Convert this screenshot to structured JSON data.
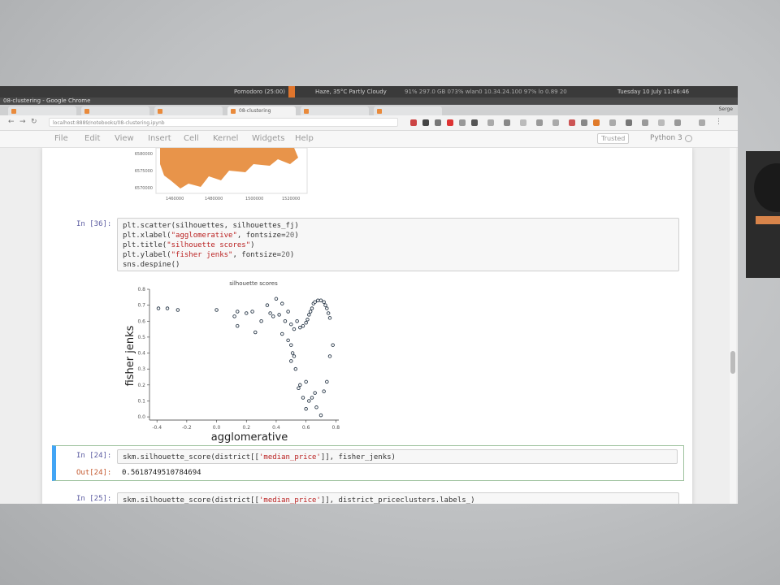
{
  "system_bar": {
    "left_text": "Pomodoro (25:00)",
    "weather": "Haze, 35°C Partly Cloudy",
    "stats": "91% 297.0 GB 073% wlan0 10.34.24.100 97% lo 0.89 20",
    "datetime": "Tuesday 10 July 11:46:46"
  },
  "window": {
    "title": "08-clustering - Google Chrome",
    "tabs": [
      {
        "label": "",
        "active": false
      },
      {
        "label": "",
        "active": false
      },
      {
        "label": "08-clustering",
        "active": true
      },
      {
        "label": "",
        "active": false
      },
      {
        "label": "",
        "active": false
      }
    ],
    "user": "Serge"
  },
  "address": {
    "url": "localhost:8889/notebooks/08-clustering.ipynb"
  },
  "menubar": {
    "items": [
      "File",
      "Edit",
      "View",
      "Insert",
      "Cell",
      "Kernel",
      "Widgets",
      "Help"
    ],
    "trusted": "Trusted",
    "kernel": "Python 3"
  },
  "map_plot": {
    "y_ticks": [
      "6580000",
      "6575000",
      "6570000"
    ],
    "x_ticks": [
      "1460000",
      "1480000",
      "1500000",
      "1520000"
    ],
    "fill_color": "#e8944a"
  },
  "cell36": {
    "prompt": "In [36]:",
    "lines": [
      [
        "plt.scatter(silhouettes, silhouettes_fj)"
      ],
      [
        "plt.xlabel(",
        "\"agglomerative\"",
        ", fontsize=",
        "20",
        ")"
      ],
      [
        "plt.title(",
        "\"silhouette scores\"",
        ")"
      ],
      [
        "plt.ylabel(",
        "\"fisher jenks\"",
        ", fontsize=",
        "20",
        ")"
      ],
      [
        "sns.despine()"
      ]
    ]
  },
  "chart_data": {
    "type": "scatter",
    "title": "silhouette scores",
    "xlabel": "agglomerative",
    "ylabel": "fisher jenks",
    "xlim": [
      -0.45,
      0.82
    ],
    "ylim": [
      -0.02,
      0.8
    ],
    "x_ticks": [
      "-0.4",
      "-0.2",
      "0.0",
      "0.2",
      "0.4",
      "0.6",
      "0.8"
    ],
    "y_ticks": [
      "0.0",
      "0.1",
      "0.2",
      "0.3",
      "0.4",
      "0.5",
      "0.6",
      "0.7",
      "0.8"
    ],
    "points": [
      [
        -0.39,
        0.68
      ],
      [
        -0.33,
        0.68
      ],
      [
        -0.26,
        0.67
      ],
      [
        0.0,
        0.67
      ],
      [
        0.12,
        0.63
      ],
      [
        0.14,
        0.66
      ],
      [
        0.14,
        0.57
      ],
      [
        0.2,
        0.65
      ],
      [
        0.24,
        0.66
      ],
      [
        0.26,
        0.53
      ],
      [
        0.3,
        0.6
      ],
      [
        0.34,
        0.7
      ],
      [
        0.36,
        0.65
      ],
      [
        0.38,
        0.63
      ],
      [
        0.4,
        0.74
      ],
      [
        0.42,
        0.64
      ],
      [
        0.44,
        0.71
      ],
      [
        0.46,
        0.6
      ],
      [
        0.48,
        0.66
      ],
      [
        0.5,
        0.58
      ],
      [
        0.52,
        0.55
      ],
      [
        0.54,
        0.6
      ],
      [
        0.56,
        0.56
      ],
      [
        0.58,
        0.57
      ],
      [
        0.6,
        0.59
      ],
      [
        0.61,
        0.61
      ],
      [
        0.62,
        0.64
      ],
      [
        0.63,
        0.66
      ],
      [
        0.64,
        0.68
      ],
      [
        0.65,
        0.71
      ],
      [
        0.66,
        0.72
      ],
      [
        0.68,
        0.73
      ],
      [
        0.7,
        0.73
      ],
      [
        0.72,
        0.72
      ],
      [
        0.73,
        0.7
      ],
      [
        0.74,
        0.68
      ],
      [
        0.75,
        0.65
      ],
      [
        0.76,
        0.62
      ],
      [
        0.48,
        0.48
      ],
      [
        0.5,
        0.45
      ],
      [
        0.51,
        0.4
      ],
      [
        0.52,
        0.38
      ],
      [
        0.5,
        0.35
      ],
      [
        0.53,
        0.3
      ],
      [
        0.44,
        0.52
      ],
      [
        0.55,
        0.18
      ],
      [
        0.56,
        0.2
      ],
      [
        0.58,
        0.12
      ],
      [
        0.6,
        0.22
      ],
      [
        0.62,
        0.1
      ],
      [
        0.64,
        0.12
      ],
      [
        0.67,
        0.06
      ],
      [
        0.7,
        0.01
      ],
      [
        0.72,
        0.16
      ],
      [
        0.74,
        0.22
      ],
      [
        0.76,
        0.38
      ],
      [
        0.78,
        0.45
      ],
      [
        0.66,
        0.15
      ],
      [
        0.6,
        0.05
      ]
    ],
    "marker_color": "#2b3a4a",
    "grid": false
  },
  "cell24": {
    "prompt_in": "In [24]:",
    "code": [
      "skm.silhouette_score(district[[",
      "'median_price'",
      "]], fisher_jenks)"
    ],
    "prompt_out": "Out[24]:",
    "output": "0.5618749510784694"
  },
  "cell25": {
    "prompt_in": "In [25]:",
    "code": [
      "skm.silhouette_score(district[[",
      "'median_price'",
      "]], district_priceclusters.labels_)"
    ]
  }
}
